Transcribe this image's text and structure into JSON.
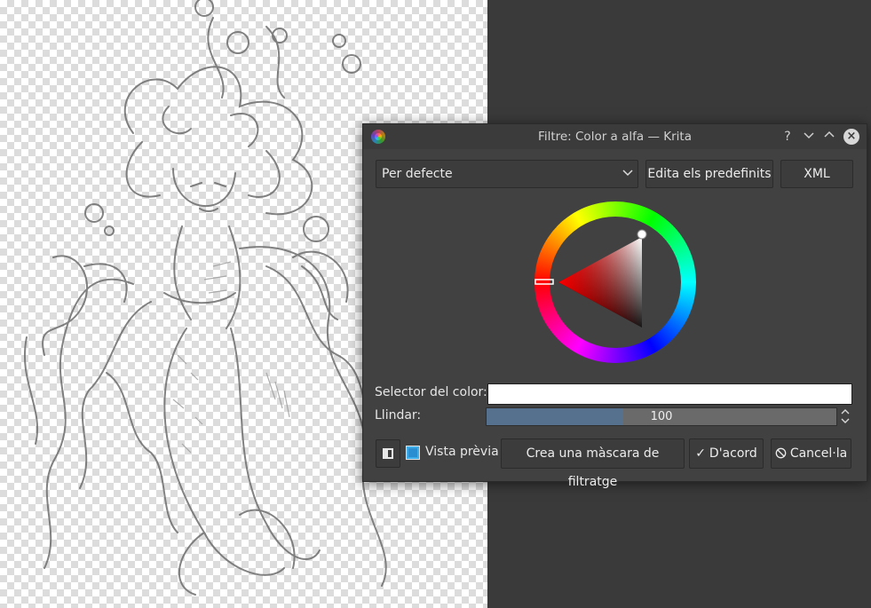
{
  "window": {
    "title": "Filtre: Color a alfa — Krita",
    "help_glyph": "?",
    "minimize_glyph": "⌄",
    "maximize_glyph": "⌃",
    "close_glyph": "×"
  },
  "preset": {
    "selected": "Per defecte",
    "edit_label": "Edita els predefinits",
    "xml_label": "XML"
  },
  "color_selector": {
    "label": "Selector del color:",
    "value_color": "#ffffff"
  },
  "threshold": {
    "label": "Llindar:",
    "value": "100",
    "fill_fraction": 0.39
  },
  "footer": {
    "preview_label": "Vista prèvia",
    "preview_checked": true,
    "mask_label": "Crea una màscara de filtratge",
    "ok_label": "D'acord",
    "ok_icon": "✓",
    "cancel_label": "Cancel·la",
    "cancel_icon": "⃠"
  },
  "colors": {
    "accent": "#3daee9",
    "dialog_bg": "#414141",
    "slider_fill": "#55718e"
  }
}
